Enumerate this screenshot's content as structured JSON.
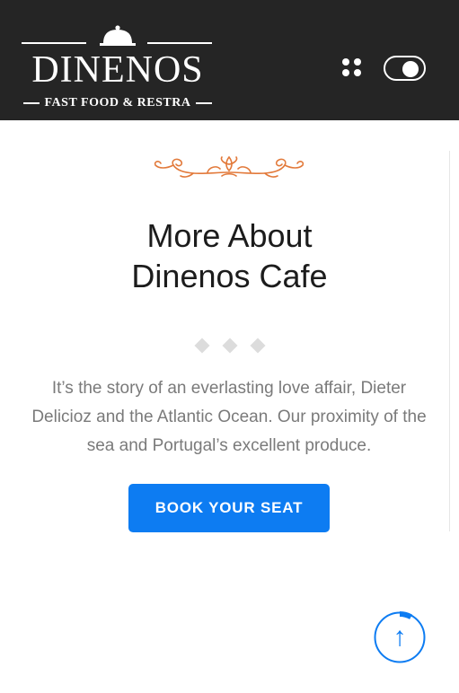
{
  "header": {
    "logo_title": "DINENOS",
    "logo_subtitle": "FAST FOOD & RESTRA",
    "menu_icon": "grid-dots-icon",
    "theme_toggle": "on"
  },
  "about": {
    "ornament_icon": "flourish-ornament-icon",
    "title_line1": "More About",
    "title_line2": "Dinenos Cafe",
    "description": "It’s the story of an everlasting love affair, Dieter Delicioz and the Atlantic Ocean. Our proximity of the sea and Portugal’s excellent produce.",
    "cta_label": "BOOK YOUR SEAT"
  },
  "scroll_top": {
    "icon": "arrow-up-icon",
    "arrow_glyph": "↑",
    "progress": 0.08
  },
  "colors": {
    "header_bg": "#252525",
    "accent": "#0d7cf2",
    "ornament": "#e2793a",
    "text_muted": "#7a7a7a"
  }
}
